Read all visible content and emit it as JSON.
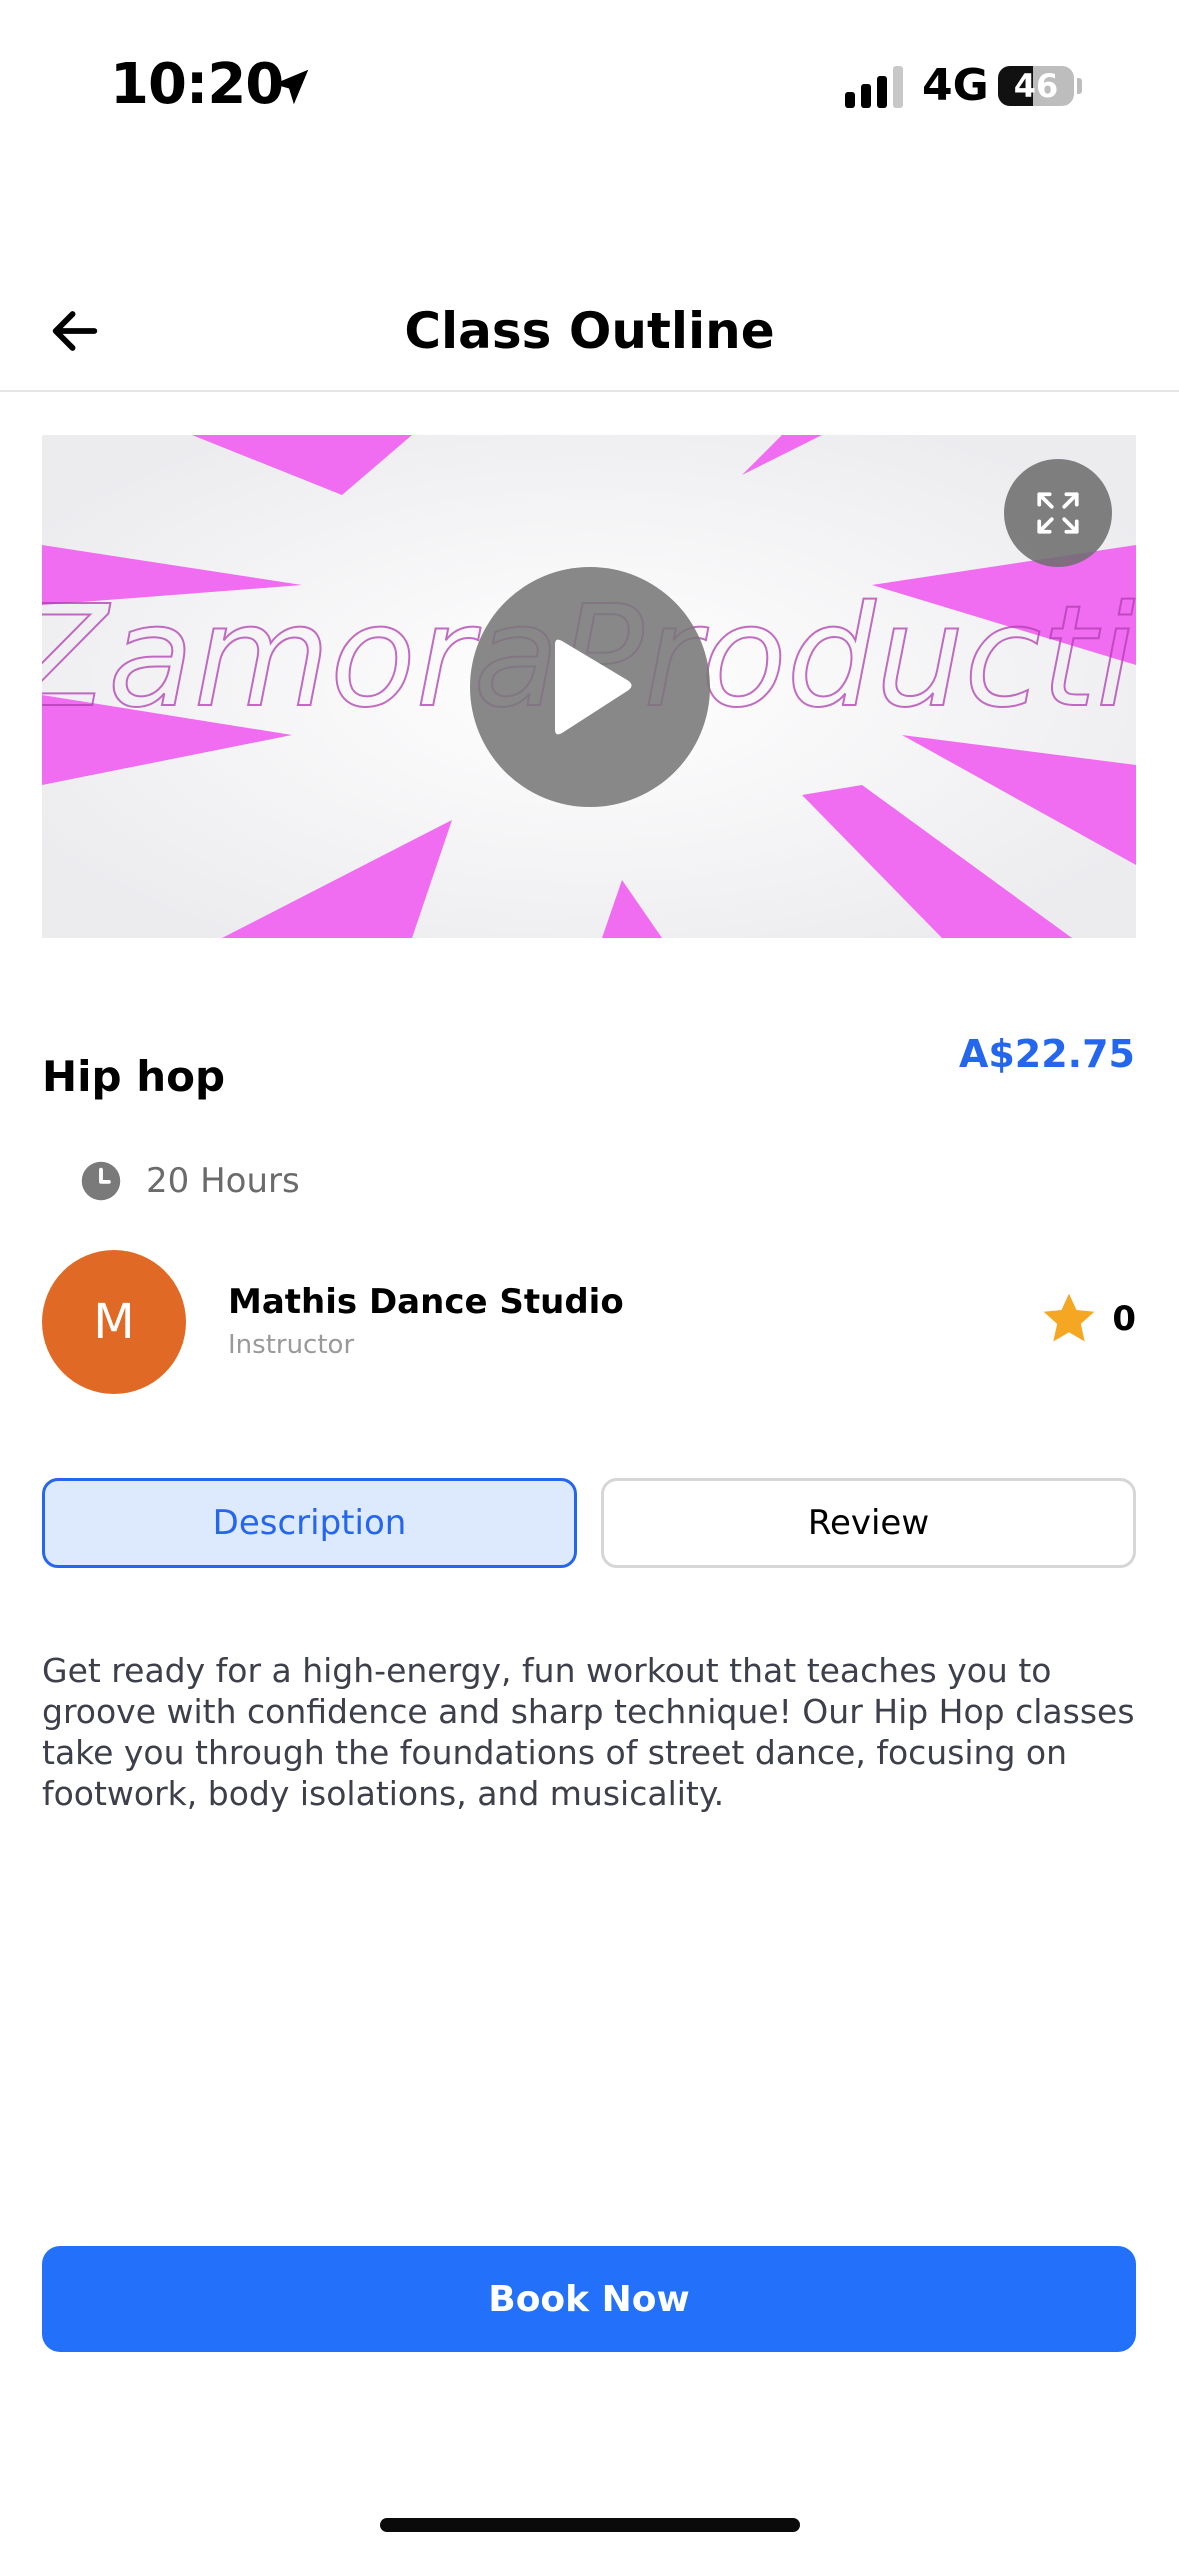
{
  "status_bar": {
    "time": "10:20",
    "network": "4G",
    "battery": "46",
    "battery_level": 0.46,
    "icons": [
      "location-arrow-icon",
      "cellular-signal-icon",
      "battery-icon"
    ]
  },
  "header": {
    "title": "Class Outline",
    "back_icon": "arrow-left-icon"
  },
  "video": {
    "overlay_text": "ZamoraProductions",
    "play_icon": "play-icon",
    "expand_icon": "expand-icon"
  },
  "class": {
    "title": "Hip hop",
    "price": "A$22.75",
    "duration": "20 Hours",
    "duration_icon": "clock-icon"
  },
  "instructor": {
    "initial": "M",
    "name": "Mathis Dance Studio",
    "role": "Instructor",
    "rating": "0",
    "rating_icon": "star-icon"
  },
  "tabs": {
    "description": "Description",
    "review": "Review",
    "active": "description"
  },
  "description_text": "Get ready for a high-energy, fun workout that teaches you to groove with confidence and sharp technique! Our Hip Hop classes take you through the foundations of street dance, focusing on footwork, body isolations, and musicality.",
  "actions": {
    "book_label": "Book Now"
  },
  "colors": {
    "primary": "#2370fb",
    "price": "#2466ee",
    "avatar": "#e06a25",
    "star": "#f5a623",
    "tab_active_bg": "#dde9fc"
  }
}
